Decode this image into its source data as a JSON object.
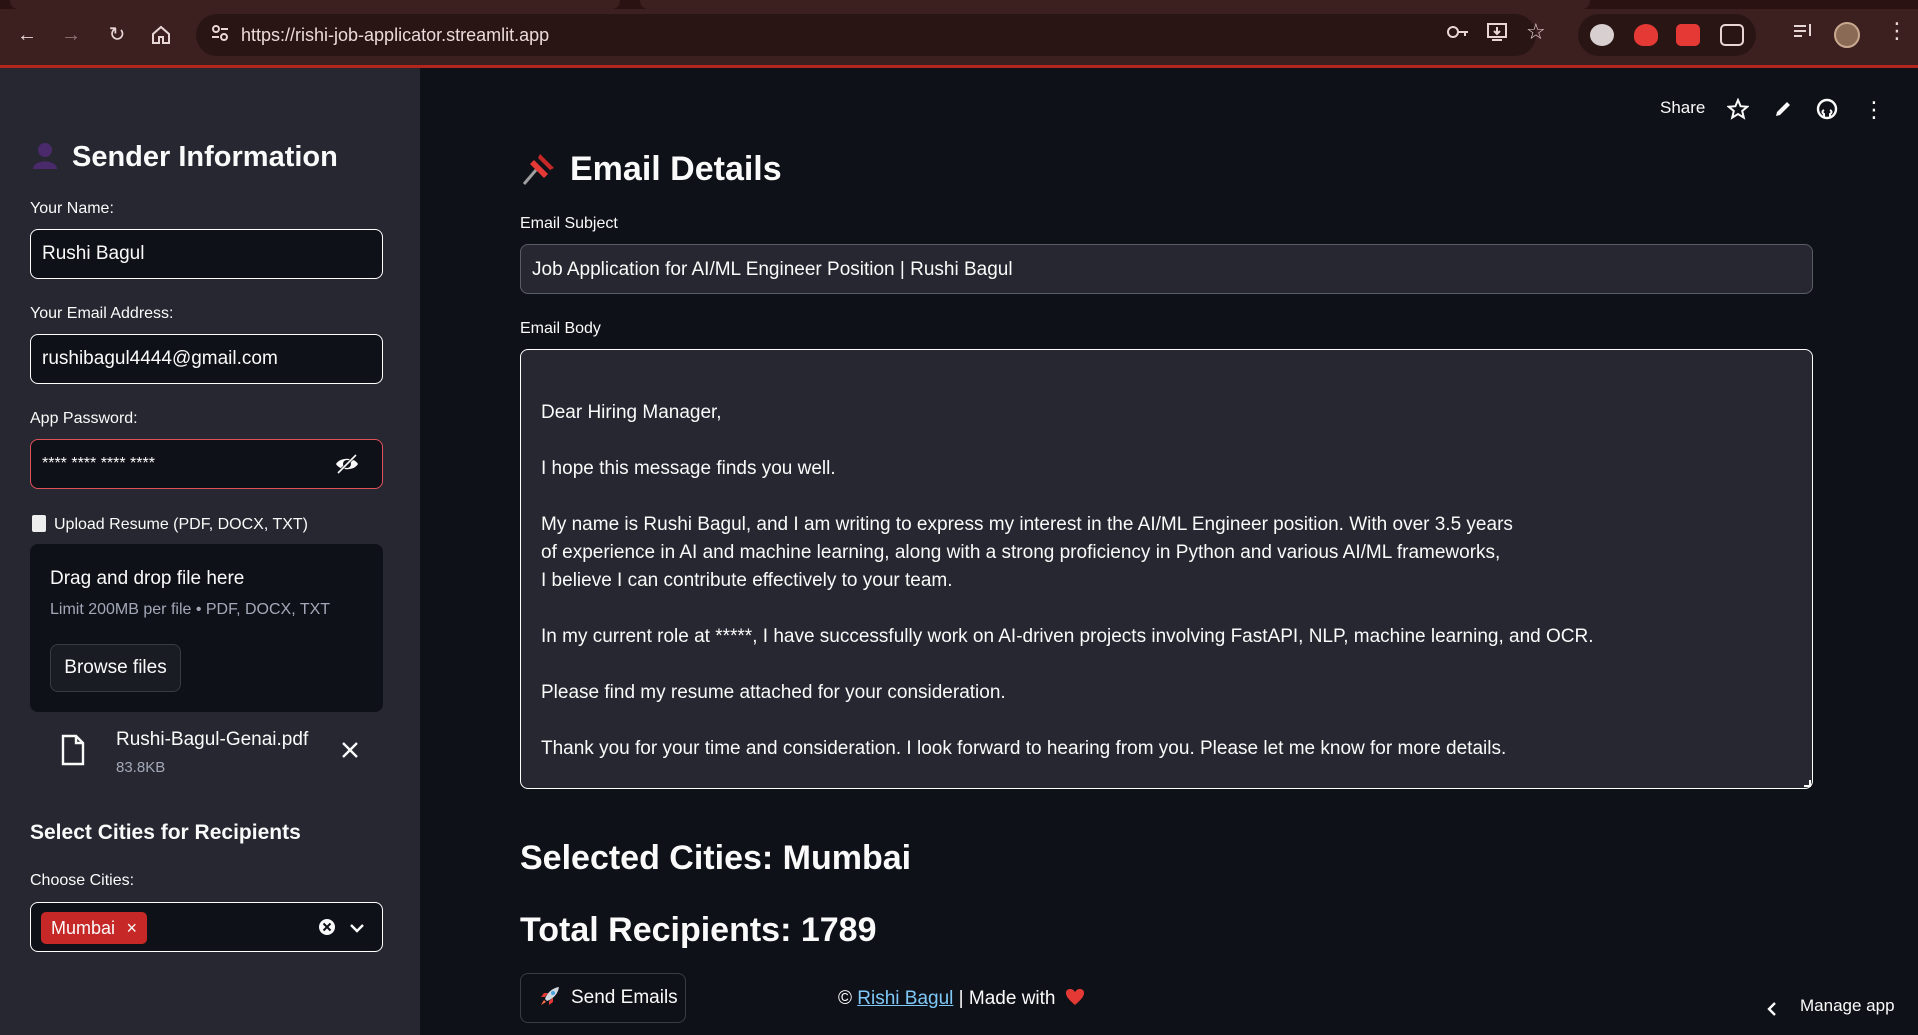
{
  "browser": {
    "url": "https://rishi-job-applicator.streamlit.app"
  },
  "header_actions": {
    "share_label": "Share"
  },
  "sidebar": {
    "title": "Sender Information",
    "name_label": "Your Name:",
    "name_value": "Rushi Bagul",
    "email_label": "Your Email Address:",
    "email_value": "rushibagul4444@gmail.com",
    "password_label": "App Password:",
    "password_value": "**** **** **** ****",
    "upload_label": "Upload Resume (PDF, DOCX, TXT)",
    "drag_drop_text": "Drag and drop file here",
    "limit_text": "Limit 200MB per file • PDF, DOCX, TXT",
    "browse_label": "Browse files",
    "file_name": "Rushi-Bagul-Genai.pdf",
    "file_size": "83.8KB",
    "cities_heading": "Select Cities for Recipients",
    "cities_label": "Choose Cities:",
    "selected_city_tag": "Mumbai"
  },
  "main": {
    "title": "Email Details",
    "subject_label": "Email Subject",
    "subject_value": "Job Application for AI/ML Engineer Position | Rushi Bagul",
    "body_label": "Email Body",
    "body_lines": [
      "Dear Hiring Manager,",
      "I hope this message finds you well.",
      "My name is Rushi Bagul, and I am writing to express my interest in the AI/ML Engineer position. With over 3.5 years",
      "of experience in AI and machine learning, along with a strong proficiency in Python and various AI/ML frameworks,",
      "I believe I can contribute effectively to your team.",
      "In my current role at *****, I have successfully work on AI-driven projects involving FastAPI, NLP, machine learning, and OCR.",
      "Please find my resume attached for your consideration.",
      "Thank you for your time and consideration. I look forward to hearing from you. Please let me know for more details."
    ],
    "selected_cities": "Selected Cities: Mumbai",
    "total_recipients": "Total Recipients: 1789",
    "send_label": "Send Emails",
    "footer_prefix": "©",
    "footer_link": "Rishi Bagul",
    "footer_suffix": "| Made with",
    "manage_app": "Manage app"
  },
  "colors": {
    "accent_red": "#c62828",
    "sidebar_bg": "#262730",
    "main_bg": "#0e1117",
    "link": "#7fc8f8"
  }
}
